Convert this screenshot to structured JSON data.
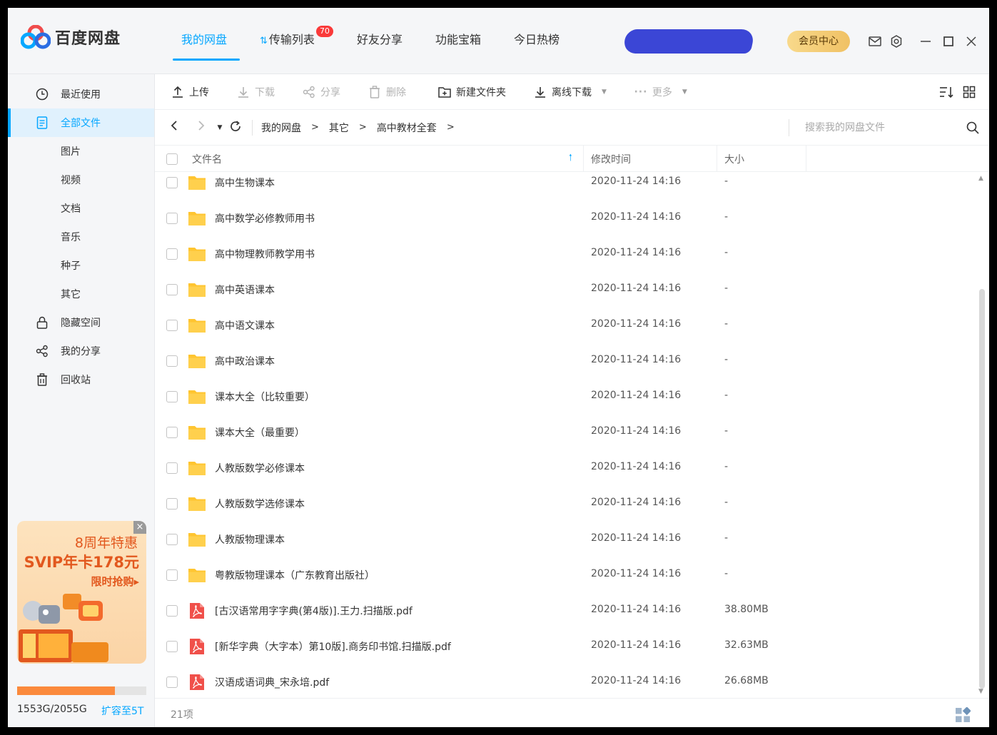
{
  "app": {
    "name": "百度网盘"
  },
  "nav": {
    "items": [
      {
        "label": "我的网盘",
        "active": true
      },
      {
        "label": "传输列表",
        "badge": "70"
      },
      {
        "label": "好友分享"
      },
      {
        "label": "功能宝箱"
      },
      {
        "label": "今日热榜"
      }
    ],
    "vip_label": "会员中心"
  },
  "sidebar": {
    "items": [
      {
        "label": "最近使用",
        "icon": "clock-icon"
      },
      {
        "label": "全部文件",
        "icon": "document-icon",
        "active": true
      },
      {
        "label": "图片"
      },
      {
        "label": "视频"
      },
      {
        "label": "文档"
      },
      {
        "label": "音乐"
      },
      {
        "label": "种子"
      },
      {
        "label": "其它"
      },
      {
        "label": "隐藏空间",
        "icon": "lock-icon"
      },
      {
        "label": "我的分享",
        "icon": "share-icon"
      },
      {
        "label": "回收站",
        "icon": "trash-icon"
      }
    ],
    "promo": {
      "line1": "8周年特惠",
      "line2": "SVIP年卡178元",
      "line3": "限时抢购▸",
      "close": "×"
    },
    "quota": {
      "text": "1553G/2055G",
      "used_fraction": 0.756,
      "expand_label": "扩容至5T"
    }
  },
  "toolbar": {
    "upload": "上传",
    "download": "下载",
    "share": "分享",
    "delete": "删除",
    "new_folder": "新建文件夹",
    "offline_download": "离线下载",
    "more": "更多"
  },
  "path": {
    "crumbs": [
      "我的网盘",
      "其它",
      "高中教材全套"
    ],
    "search_placeholder": "搜索我的网盘文件"
  },
  "table": {
    "col_name": "文件名",
    "col_mtime": "修改时间",
    "col_size": "大小",
    "rows": [
      {
        "name": "高中生物课本",
        "type": "folder",
        "mtime": "2020-11-24 14:16",
        "size": "-"
      },
      {
        "name": "高中数学必修教师用书",
        "type": "folder",
        "mtime": "2020-11-24 14:16",
        "size": "-"
      },
      {
        "name": "高中物理教师教学用书",
        "type": "folder",
        "mtime": "2020-11-24 14:16",
        "size": "-"
      },
      {
        "name": "高中英语课本",
        "type": "folder",
        "mtime": "2020-11-24 14:16",
        "size": "-"
      },
      {
        "name": "高中语文课本",
        "type": "folder",
        "mtime": "2020-11-24 14:16",
        "size": "-"
      },
      {
        "name": "高中政治课本",
        "type": "folder",
        "mtime": "2020-11-24 14:16",
        "size": "-"
      },
      {
        "name": "课本大全（比较重要）",
        "type": "folder",
        "mtime": "2020-11-24 14:16",
        "size": "-"
      },
      {
        "name": "课本大全（最重要）",
        "type": "folder",
        "mtime": "2020-11-24 14:16",
        "size": "-"
      },
      {
        "name": "人教版数学必修课本",
        "type": "folder",
        "mtime": "2020-11-24 14:16",
        "size": "-"
      },
      {
        "name": "人教版数学选修课本",
        "type": "folder",
        "mtime": "2020-11-24 14:16",
        "size": "-"
      },
      {
        "name": "人教版物理课本",
        "type": "folder",
        "mtime": "2020-11-24 14:16",
        "size": "-"
      },
      {
        "name": "粤教版物理课本（广东教育出版社）",
        "type": "folder",
        "mtime": "2020-11-24 14:16",
        "size": "-"
      },
      {
        "name": "[古汉语常用字字典(第4版)].王力.扫描版.pdf",
        "type": "pdf",
        "mtime": "2020-11-24 14:16",
        "size": "38.80MB"
      },
      {
        "name": "[新华字典（大字本）第10版].商务印书馆.扫描版.pdf",
        "type": "pdf",
        "mtime": "2020-11-24 14:16",
        "size": "32.63MB"
      },
      {
        "name": "汉语成语词典_宋永培.pdf",
        "type": "pdf",
        "mtime": "2020-11-24 14:16",
        "size": "26.68MB"
      }
    ]
  },
  "footer": {
    "count": "21项"
  },
  "colors": {
    "accent": "#06a7ff",
    "folder": "#ffc530",
    "pdf": "#f0504a",
    "promo_text": "#e2581e"
  }
}
